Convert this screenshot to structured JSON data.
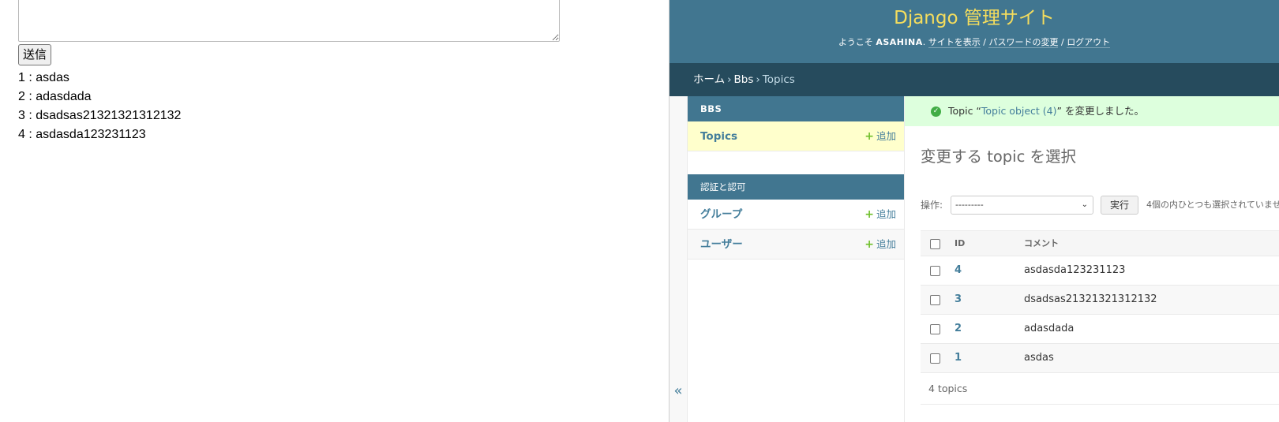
{
  "bbs_page": {
    "textarea_value": "",
    "submit_label": "送信",
    "posts": [
      "1 : asdas",
      "2 : adasdada",
      "3 : dsadsas21321321312132",
      "4 : asdasda123231123"
    ]
  },
  "admin": {
    "site_title": "Django 管理サイト",
    "user_tools": {
      "welcome": "ようこそ",
      "username": "ASAHINA",
      "view_site": "サイトを表示",
      "change_password": "パスワードの変更",
      "logout": "ログアウト"
    },
    "breadcrumbs": {
      "home": "ホーム",
      "app": "Bbs",
      "current": "Topics",
      "separator": "›"
    },
    "sidebar": {
      "toggle_glyph": "«",
      "apps": [
        {
          "caption": "BBS",
          "models": [
            {
              "name": "Topics",
              "add_label": "追加"
            }
          ]
        },
        {
          "caption": "認証と認可",
          "models": [
            {
              "name": "グループ",
              "add_label": "追加"
            },
            {
              "name": "ユーザー",
              "add_label": "追加"
            }
          ]
        }
      ],
      "add_icon": "plus-icon"
    },
    "message": {
      "icon": "check-circle-icon",
      "prefix": "Topic “",
      "link_text": "Topic object (4)",
      "suffix": "” を変更しました。"
    },
    "heading": "変更する topic を選択",
    "actions": {
      "label": "操作:",
      "selected_option": "---------",
      "go_label": "実行",
      "counter": "4個の内ひとつも選択されていませ"
    },
    "table": {
      "columns": [
        "ID",
        "コメント"
      ],
      "rows": [
        {
          "id": "4",
          "comment": "asdasda123231123"
        },
        {
          "id": "3",
          "comment": "dsadsas21321321312132"
        },
        {
          "id": "2",
          "comment": "adasdada"
        },
        {
          "id": "1",
          "comment": "asdas"
        }
      ]
    },
    "paginator": "4 topics"
  },
  "colors": {
    "header_bg": "#417690",
    "site_title": "#f5dd5d",
    "breadcrumbs_bg": "#264b5d",
    "link": "#447e9b",
    "current_model_bg": "#ffffcc",
    "success_bg": "#ddffdd",
    "add_plus": "#70bf2b"
  }
}
